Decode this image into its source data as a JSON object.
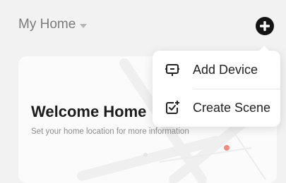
{
  "header": {
    "home_name": "My Home",
    "caret_icon": "caret-down-icon",
    "add_icon": "plus-circle-icon"
  },
  "card": {
    "title": "Welcome Home",
    "subtitle": "Set your home location for more information"
  },
  "menu": {
    "items": [
      {
        "label": "Add Device",
        "icon": "device-icon"
      },
      {
        "label": "Create Scene",
        "icon": "scene-icon"
      }
    ]
  },
  "colors": {
    "background": "#f2f2f2",
    "card": "#fbfbfb",
    "text_primary": "#1c1c1c",
    "text_muted": "#8d8d8d",
    "accent_dot": "#f08a80"
  }
}
